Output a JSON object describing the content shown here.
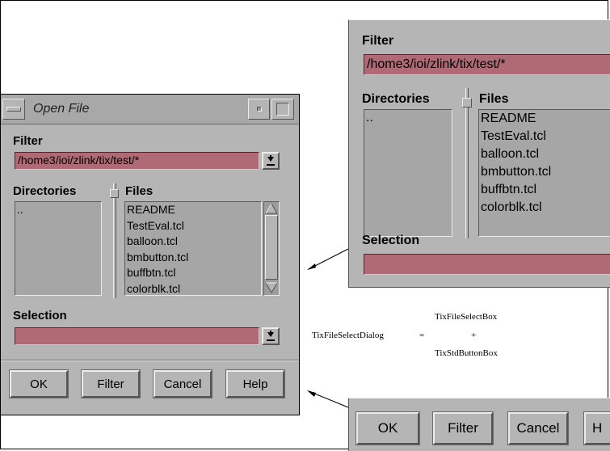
{
  "dialog": {
    "title": "Open File",
    "filter_label": "Filter",
    "filter_value": "/home3/ioi/zlink/tix/test/*",
    "directories_label": "Directories",
    "directories": [
      ".."
    ],
    "files_label": "Files",
    "files": [
      "README",
      "TestEval.tcl",
      "balloon.tcl",
      "bmbutton.tcl",
      "buffbtn.tcl",
      "colorblk.tcl"
    ],
    "selection_label": "Selection",
    "selection_value": "",
    "buttons": {
      "ok": "OK",
      "filter": "Filter",
      "cancel": "Cancel",
      "help": "Help"
    }
  },
  "zoom_fileselectbox": {
    "filter_label": "Filter",
    "filter_value": "/home3/ioi/zlink/tix/test/*",
    "directories_label": "Directories",
    "directories": [
      ".."
    ],
    "files_label": "Files",
    "files": [
      "README",
      "TestEval.tcl",
      "balloon.tcl",
      "bmbutton.tcl",
      "buffbtn.tcl",
      "colorblk.tcl"
    ],
    "selection_label": "Selection"
  },
  "zoom_buttonbox": {
    "ok": "OK",
    "filter": "Filter",
    "cancel": "Cancel",
    "help": "H"
  },
  "equation": {
    "lhs": "TixFileSelectDialog",
    "equals": "=",
    "top": "TixFileSelectBox",
    "plus": "+",
    "bottom": "TixStdButtonBox"
  },
  "colors": {
    "entry": "#b06a76",
    "background": "#b5b5b5",
    "list": "#a6a6a6"
  },
  "icons": [
    "window-menu-icon",
    "minimize-icon",
    "maximize-icon",
    "combo-arrow-icon",
    "scroll-up-icon",
    "scroll-down-icon",
    "pointer-arrow-icon"
  ]
}
